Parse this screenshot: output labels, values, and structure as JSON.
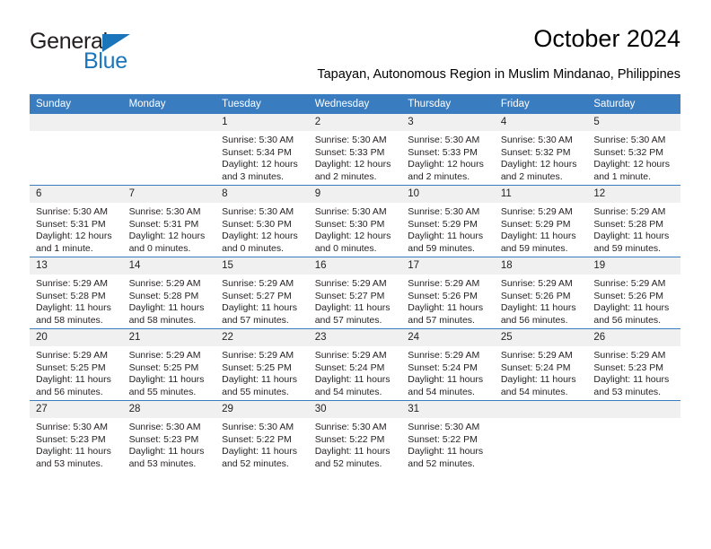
{
  "logo": {
    "name_top": "General",
    "name_bottom": "Blue",
    "accent_color": "#1b75bb",
    "triangle_icon": "triangle-icon"
  },
  "header": {
    "title": "October 2024",
    "subtitle": "Tapayan, Autonomous Region in Muslim Mindanao, Philippines"
  },
  "theme": {
    "header_blue": "#3a7cc0",
    "daynum_band": "#f0f0f0",
    "text": "#231f20"
  },
  "calendar": {
    "weekday_headers": [
      "Sunday",
      "Monday",
      "Tuesday",
      "Wednesday",
      "Thursday",
      "Friday",
      "Saturday"
    ],
    "weeks": [
      [
        {
          "day": "",
          "sunrise": "",
          "sunset": "",
          "daylight": ""
        },
        {
          "day": "",
          "sunrise": "",
          "sunset": "",
          "daylight": ""
        },
        {
          "day": "1",
          "sunrise": "Sunrise: 5:30 AM",
          "sunset": "Sunset: 5:34 PM",
          "daylight": "Daylight: 12 hours and 3 minutes."
        },
        {
          "day": "2",
          "sunrise": "Sunrise: 5:30 AM",
          "sunset": "Sunset: 5:33 PM",
          "daylight": "Daylight: 12 hours and 2 minutes."
        },
        {
          "day": "3",
          "sunrise": "Sunrise: 5:30 AM",
          "sunset": "Sunset: 5:33 PM",
          "daylight": "Daylight: 12 hours and 2 minutes."
        },
        {
          "day": "4",
          "sunrise": "Sunrise: 5:30 AM",
          "sunset": "Sunset: 5:32 PM",
          "daylight": "Daylight: 12 hours and 2 minutes."
        },
        {
          "day": "5",
          "sunrise": "Sunrise: 5:30 AM",
          "sunset": "Sunset: 5:32 PM",
          "daylight": "Daylight: 12 hours and 1 minute."
        }
      ],
      [
        {
          "day": "6",
          "sunrise": "Sunrise: 5:30 AM",
          "sunset": "Sunset: 5:31 PM",
          "daylight": "Daylight: 12 hours and 1 minute."
        },
        {
          "day": "7",
          "sunrise": "Sunrise: 5:30 AM",
          "sunset": "Sunset: 5:31 PM",
          "daylight": "Daylight: 12 hours and 0 minutes."
        },
        {
          "day": "8",
          "sunrise": "Sunrise: 5:30 AM",
          "sunset": "Sunset: 5:30 PM",
          "daylight": "Daylight: 12 hours and 0 minutes."
        },
        {
          "day": "9",
          "sunrise": "Sunrise: 5:30 AM",
          "sunset": "Sunset: 5:30 PM",
          "daylight": "Daylight: 12 hours and 0 minutes."
        },
        {
          "day": "10",
          "sunrise": "Sunrise: 5:30 AM",
          "sunset": "Sunset: 5:29 PM",
          "daylight": "Daylight: 11 hours and 59 minutes."
        },
        {
          "day": "11",
          "sunrise": "Sunrise: 5:29 AM",
          "sunset": "Sunset: 5:29 PM",
          "daylight": "Daylight: 11 hours and 59 minutes."
        },
        {
          "day": "12",
          "sunrise": "Sunrise: 5:29 AM",
          "sunset": "Sunset: 5:28 PM",
          "daylight": "Daylight: 11 hours and 59 minutes."
        }
      ],
      [
        {
          "day": "13",
          "sunrise": "Sunrise: 5:29 AM",
          "sunset": "Sunset: 5:28 PM",
          "daylight": "Daylight: 11 hours and 58 minutes."
        },
        {
          "day": "14",
          "sunrise": "Sunrise: 5:29 AM",
          "sunset": "Sunset: 5:28 PM",
          "daylight": "Daylight: 11 hours and 58 minutes."
        },
        {
          "day": "15",
          "sunrise": "Sunrise: 5:29 AM",
          "sunset": "Sunset: 5:27 PM",
          "daylight": "Daylight: 11 hours and 57 minutes."
        },
        {
          "day": "16",
          "sunrise": "Sunrise: 5:29 AM",
          "sunset": "Sunset: 5:27 PM",
          "daylight": "Daylight: 11 hours and 57 minutes."
        },
        {
          "day": "17",
          "sunrise": "Sunrise: 5:29 AM",
          "sunset": "Sunset: 5:26 PM",
          "daylight": "Daylight: 11 hours and 57 minutes."
        },
        {
          "day": "18",
          "sunrise": "Sunrise: 5:29 AM",
          "sunset": "Sunset: 5:26 PM",
          "daylight": "Daylight: 11 hours and 56 minutes."
        },
        {
          "day": "19",
          "sunrise": "Sunrise: 5:29 AM",
          "sunset": "Sunset: 5:26 PM",
          "daylight": "Daylight: 11 hours and 56 minutes."
        }
      ],
      [
        {
          "day": "20",
          "sunrise": "Sunrise: 5:29 AM",
          "sunset": "Sunset: 5:25 PM",
          "daylight": "Daylight: 11 hours and 56 minutes."
        },
        {
          "day": "21",
          "sunrise": "Sunrise: 5:29 AM",
          "sunset": "Sunset: 5:25 PM",
          "daylight": "Daylight: 11 hours and 55 minutes."
        },
        {
          "day": "22",
          "sunrise": "Sunrise: 5:29 AM",
          "sunset": "Sunset: 5:25 PM",
          "daylight": "Daylight: 11 hours and 55 minutes."
        },
        {
          "day": "23",
          "sunrise": "Sunrise: 5:29 AM",
          "sunset": "Sunset: 5:24 PM",
          "daylight": "Daylight: 11 hours and 54 minutes."
        },
        {
          "day": "24",
          "sunrise": "Sunrise: 5:29 AM",
          "sunset": "Sunset: 5:24 PM",
          "daylight": "Daylight: 11 hours and 54 minutes."
        },
        {
          "day": "25",
          "sunrise": "Sunrise: 5:29 AM",
          "sunset": "Sunset: 5:24 PM",
          "daylight": "Daylight: 11 hours and 54 minutes."
        },
        {
          "day": "26",
          "sunrise": "Sunrise: 5:29 AM",
          "sunset": "Sunset: 5:23 PM",
          "daylight": "Daylight: 11 hours and 53 minutes."
        }
      ],
      [
        {
          "day": "27",
          "sunrise": "Sunrise: 5:30 AM",
          "sunset": "Sunset: 5:23 PM",
          "daylight": "Daylight: 11 hours and 53 minutes."
        },
        {
          "day": "28",
          "sunrise": "Sunrise: 5:30 AM",
          "sunset": "Sunset: 5:23 PM",
          "daylight": "Daylight: 11 hours and 53 minutes."
        },
        {
          "day": "29",
          "sunrise": "Sunrise: 5:30 AM",
          "sunset": "Sunset: 5:22 PM",
          "daylight": "Daylight: 11 hours and 52 minutes."
        },
        {
          "day": "30",
          "sunrise": "Sunrise: 5:30 AM",
          "sunset": "Sunset: 5:22 PM",
          "daylight": "Daylight: 11 hours and 52 minutes."
        },
        {
          "day": "31",
          "sunrise": "Sunrise: 5:30 AM",
          "sunset": "Sunset: 5:22 PM",
          "daylight": "Daylight: 11 hours and 52 minutes."
        },
        {
          "day": "",
          "sunrise": "",
          "sunset": "",
          "daylight": ""
        },
        {
          "day": "",
          "sunrise": "",
          "sunset": "",
          "daylight": ""
        }
      ]
    ]
  }
}
